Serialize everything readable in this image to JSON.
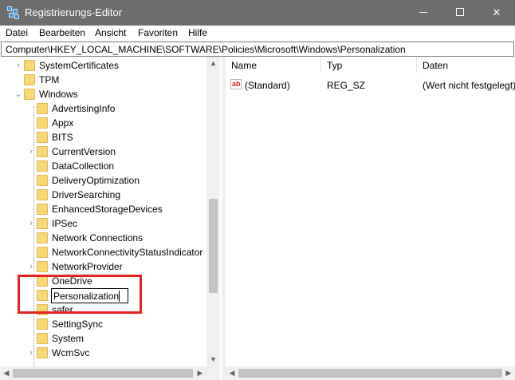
{
  "window": {
    "title": "Registrierungs-Editor",
    "min_icon": "minimize-icon",
    "max_icon": "maximize-icon",
    "close_icon": "close-icon",
    "close_glyph": "✕"
  },
  "menu": [
    "Datei",
    "Bearbeiten",
    "Ansicht",
    "Favoriten",
    "Hilfe"
  ],
  "address": "Computer\\HKEY_LOCAL_MACHINE\\SOFTWARE\\Policies\\Microsoft\\Windows\\Personalization",
  "tree": {
    "items": [
      {
        "label": "SystemCertificates"
      },
      {
        "label": "TPM"
      },
      {
        "label": "Windows"
      },
      {
        "label": "AdvertisingInfo"
      },
      {
        "label": "Appx"
      },
      {
        "label": "BITS"
      },
      {
        "label": "CurrentVersion"
      },
      {
        "label": "DataCollection"
      },
      {
        "label": "DeliveryOptimization"
      },
      {
        "label": "DriverSearching"
      },
      {
        "label": "EnhancedStorageDevices"
      },
      {
        "label": "IPSec"
      },
      {
        "label": "Network Connections"
      },
      {
        "label": "NetworkConnectivityStatusIndicator"
      },
      {
        "label": "NetworkProvider"
      },
      {
        "label": "OneDrive"
      },
      {
        "label": "safer"
      },
      {
        "label": "SettingSync"
      },
      {
        "label": "System"
      },
      {
        "label": "WcmSvc"
      }
    ],
    "editing_value": "Personalization",
    "expanders": {
      "collapsed": "›",
      "expanded": "⌄"
    }
  },
  "list": {
    "columns": [
      "Name",
      "Typ",
      "Daten"
    ],
    "rows": [
      {
        "icon": "ab",
        "name": "(Standard)",
        "type": "REG_SZ",
        "data": "(Wert nicht festgelegt)"
      }
    ]
  },
  "scroll": {
    "up": "▲",
    "down": "▼",
    "left": "◀",
    "right": "▶"
  },
  "colors": {
    "titlebar": "#6d6d6d",
    "highlight": "#e8201f",
    "folder": "#f8d775"
  }
}
